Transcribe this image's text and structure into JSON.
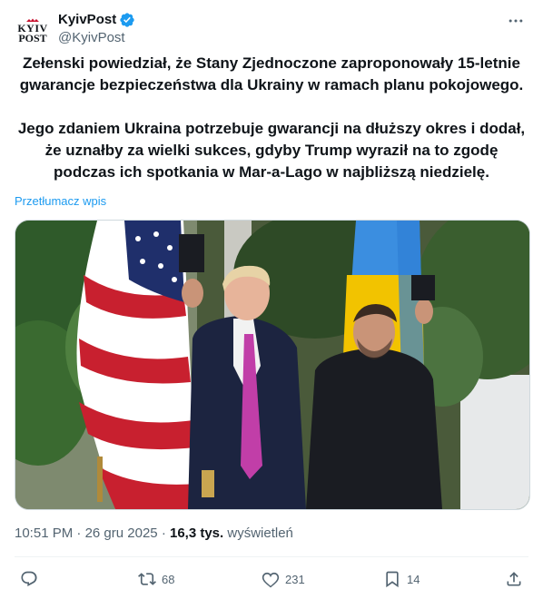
{
  "account": {
    "logo_top": "KYIV",
    "logo_bottom": "POST",
    "display_name": "KyivPost",
    "handle": "@KyivPost"
  },
  "tweet": {
    "paragraph1": "Zełenski powiedział, że Stany Zjednoczone zaproponowały 15-letnie\ngwarancje bezpieczeństwa dla Ukrainy w ramach planu pokojowego.",
    "paragraph2": "Jego zdaniem Ukraina potrzebuje gwarancji na dłuższy okres i dodał,\nże uznałby za wielki sukces, gdyby Trump wyraził na to zgodę\npodczas ich spotkania w Mar-a-Lago w najbliższą niedzielę.",
    "translate_label": "Przetłumacz wpis"
  },
  "meta": {
    "time": "10:51 PM",
    "date": "26 gru 2025",
    "views_count": "16,3 tys.",
    "views_label": "wyświetleń"
  },
  "actions": {
    "reply_count": "",
    "retweet_count": "68",
    "like_count": "231",
    "bookmark_count": "14"
  },
  "icons": [
    "verified-badge-icon",
    "more-icon",
    "reply-icon",
    "retweet-icon",
    "like-icon",
    "bookmark-icon",
    "share-icon"
  ],
  "colors": {
    "accent": "#1d9bf0",
    "secondary_text": "#536471",
    "primary_text": "#0f1419"
  }
}
